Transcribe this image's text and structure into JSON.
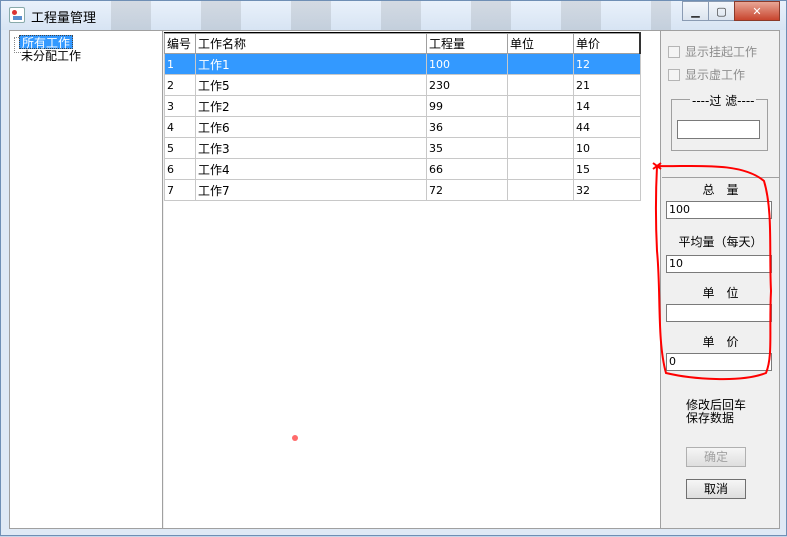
{
  "window": {
    "title": "工程量管理",
    "controls": {
      "minimize": "▁",
      "maximize": "▢",
      "close": "✕"
    }
  },
  "tree": {
    "items": [
      {
        "label": "所有工作",
        "selected": true
      },
      {
        "label": "未分配工作",
        "selected": false
      }
    ]
  },
  "grid": {
    "columns": [
      "编号",
      "工作名称",
      "工程量",
      "单位",
      "单价"
    ],
    "rows": [
      {
        "id": "1",
        "name": "工作1",
        "qty": "100",
        "unit": "",
        "price": "12",
        "selected": true
      },
      {
        "id": "2",
        "name": "工作5",
        "qty": "230",
        "unit": "",
        "price": "21"
      },
      {
        "id": "3",
        "name": "工作2",
        "qty": "99",
        "unit": "",
        "price": "14"
      },
      {
        "id": "4",
        "name": "工作6",
        "qty": "36",
        "unit": "",
        "price": "44"
      },
      {
        "id": "5",
        "name": "工作3",
        "qty": "35",
        "unit": "",
        "price": "10"
      },
      {
        "id": "6",
        "name": "工作4",
        "qty": "66",
        "unit": "",
        "price": "15"
      },
      {
        "id": "7",
        "name": "工作7",
        "qty": "72",
        "unit": "",
        "price": "32"
      }
    ]
  },
  "panel": {
    "show_suspended": "显示挂起工作",
    "show_virtual": "显示虚工作",
    "filter_legend": "过 滤",
    "filter_value": "",
    "total_label": "总　量",
    "total_value": "100",
    "avg_label": "平均量（每天）",
    "avg_value": "10",
    "unit_label": "单　位",
    "unit_value": "",
    "price_label": "单　价",
    "price_value": "0",
    "note_line1": "修改后回车",
    "note_line2": "保存数据",
    "ok_label": "确定",
    "cancel_label": "取消"
  },
  "colors": {
    "selection": "#3399ff",
    "annotation": "#ff0000"
  }
}
